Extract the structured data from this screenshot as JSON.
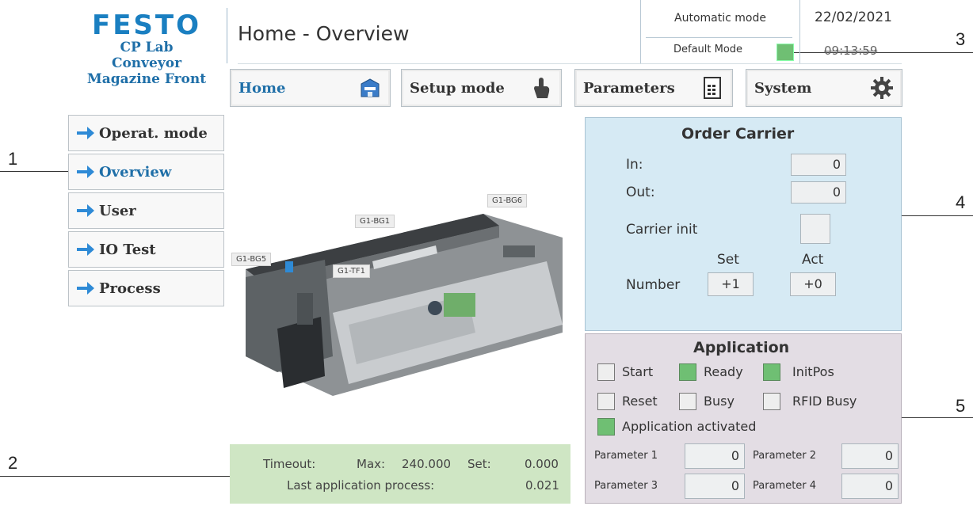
{
  "callouts": [
    "1",
    "2",
    "3",
    "4",
    "5"
  ],
  "logo": {
    "brand": "FESTO",
    "line1": "CP Lab",
    "line2": "Conveyor",
    "line3": "Magazine Front"
  },
  "header": {
    "title": "Home - Overview",
    "mode": "Automatic mode",
    "default_mode": "Default Mode",
    "date": "22/02/2021",
    "time": "09:13:59"
  },
  "tabs": [
    {
      "label": "Home",
      "icon": "home-icon"
    },
    {
      "label": "Setup mode",
      "icon": "hand-pointer-icon"
    },
    {
      "label": "Parameters",
      "icon": "parameters-icon"
    },
    {
      "label": "System",
      "icon": "gear-icon"
    }
  ],
  "nav": [
    {
      "label": "Operat. mode"
    },
    {
      "label": "Overview"
    },
    {
      "label": "User"
    },
    {
      "label": "IO Test"
    },
    {
      "label": "Process"
    }
  ],
  "machine_tags": [
    "G1-BG6",
    "G1-BG1",
    "G1-BG5",
    "G1-TF1"
  ],
  "timeout": {
    "timeout_label": "Timeout:",
    "max_label": "Max:",
    "max_value": "240.000",
    "set_label": "Set:",
    "set_value": "0.000",
    "last_label": "Last application process:",
    "last_value": "0.021"
  },
  "order_carrier": {
    "title": "Order Carrier",
    "in_label": "In:",
    "in_value": "0",
    "out_label": "Out:",
    "out_value": "0",
    "carrier_init_label": "Carrier init",
    "set_label": "Set",
    "act_label": "Act",
    "number_label": "Number",
    "set_value": "+1",
    "act_value": "+0"
  },
  "application": {
    "title": "Application",
    "start": "Start",
    "ready": "Ready",
    "initpos": "InitPos",
    "reset": "Reset",
    "busy": "Busy",
    "rfid_busy": "RFID Busy",
    "activated": "Application activated",
    "param1_label": "Parameter 1",
    "param1_value": "0",
    "param2_label": "Parameter 2",
    "param2_value": "0",
    "param3_label": "Parameter 3",
    "param3_value": "0",
    "param4_label": "Parameter 4",
    "param4_value": "0"
  },
  "colors": {
    "accent": "#1f6fa8",
    "led_green": "#6fbf73",
    "order_bg": "#d6eaf4",
    "app_bg": "#e3dde4",
    "timeout_bg": "#cfe6c4"
  }
}
